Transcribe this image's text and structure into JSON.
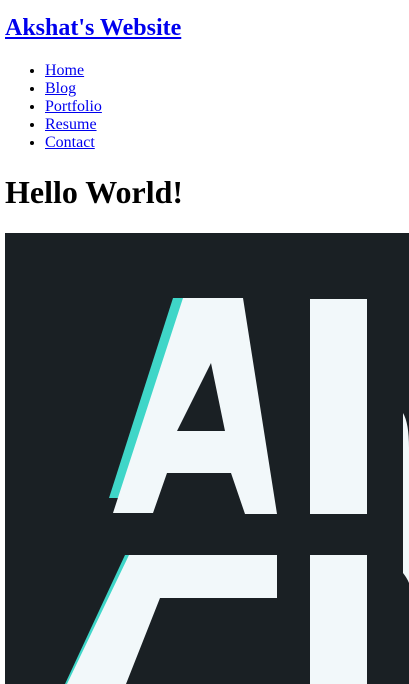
{
  "site": {
    "title": "Akshat's Website"
  },
  "nav": {
    "items": [
      {
        "label": "Home"
      },
      {
        "label": "Blog"
      },
      {
        "label": "Portfolio"
      },
      {
        "label": "Resume"
      },
      {
        "label": "Contact"
      }
    ]
  },
  "main": {
    "heading": "Hello World!"
  },
  "colors": {
    "link": "#0000ee",
    "hero_background": "#1a2024",
    "hero_glyph": "#f2f8fa",
    "hero_glyph_edge": "#3fd6c8"
  },
  "hero": {
    "icon": "logo-image"
  }
}
